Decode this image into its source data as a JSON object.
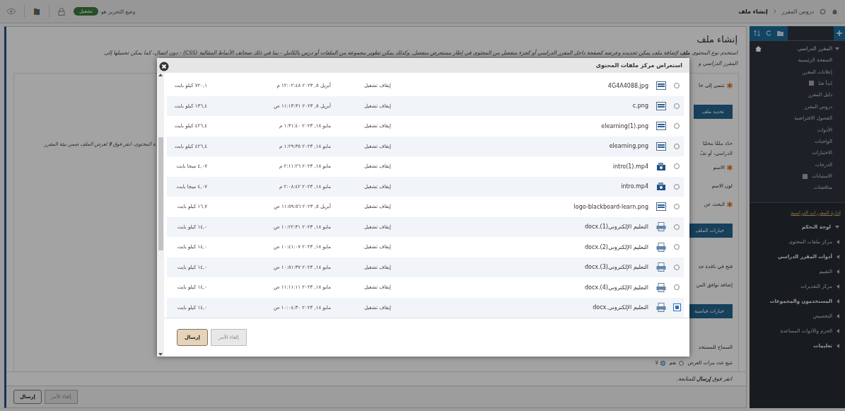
{
  "top_bar": {
    "breadcrumb": [
      {
        "label": "دروس المقرر"
      },
      {
        "label": "إنشاء ملف"
      }
    ],
    "edit_mode": {
      "label": "وضع التحرير هو",
      "state": "تشغيل",
      "on": true
    }
  },
  "sidebar": {
    "course_title": "المقرر الدراسي",
    "course_expanded": true,
    "course_items": [
      {
        "label": "الصفحة الرئيسية",
        "kind": "link"
      },
      {
        "label": "إعلانات المقرر",
        "kind": "link"
      },
      {
        "label": "ابدأ هنا",
        "kind": "flagged"
      },
      {
        "label": "دليل المقرر",
        "kind": "link"
      },
      {
        "label": "دروس المقرر",
        "kind": "link"
      },
      {
        "label": "الفصول الافتراضية",
        "kind": "link"
      },
      {
        "label": "الأدوات",
        "kind": "link"
      },
      {
        "label": "الواجبات",
        "kind": "link"
      },
      {
        "label": "الاختبارات",
        "kind": "link"
      },
      {
        "label": "الدرجات",
        "kind": "link"
      },
      {
        "label": "الاستبانات",
        "kind": "flagged"
      },
      {
        "label": "مناقشات",
        "kind": "link"
      }
    ],
    "management_title": "إدارة المقررات الدراسية",
    "control_panel": "لوحة التحكم",
    "control_panel_expanded": true,
    "management_items": [
      {
        "label": "مركز ملفات المحتوى",
        "bold": false
      },
      {
        "label": "أدوات المقرر الدراسي",
        "bold": true
      },
      {
        "label": "التقييم",
        "bold": false
      },
      {
        "label": "مركز التقديرات",
        "bold": false
      },
      {
        "label": "المستخدمون والمجموعات",
        "bold": true
      },
      {
        "label": "التخصيص",
        "bold": false
      },
      {
        "label": "الحزم والأدوات المساعدة",
        "bold": false
      },
      {
        "label": "تعليمات",
        "bold": true
      }
    ]
  },
  "page": {
    "title": "إنشاء ملف",
    "description": "استخدم نوع المحتوى **ملف** لإضافة ملف يمكن تحديده وعرضه كصفحة داخل المقرر الدراسي أو كجزء منفصل من المحتوى في إطار مستعرض منفصل. وكذلك يمكن تطوير مجموعة من الملفات أو درس بالكامل - بما في ذلك صحائف الأنماط المتتالية (CSS) - دون اتصال، كما يمكن تحميلها إلى",
    "description_cont": "المقرر الدراسي و",
    "form": [
      {
        "kind": "label",
        "text": "تنتمي إلى حا",
        "required": true
      },
      {
        "kind": "button",
        "text": "تحديد ملف"
      },
      {
        "kind": "text",
        "text": "حدّد ملفًا محليًا"
      },
      {
        "kind": "text",
        "text": "الدراسي، أو نفّ"
      },
      {
        "kind": "label",
        "text": "الاسم",
        "required": true
      },
      {
        "kind": "label",
        "text": "لون الاسم",
        "required": false
      },
      {
        "kind": "label",
        "text": "البحث عن",
        "required": true
      },
      {
        "kind": "button",
        "text": "خيارات الملف"
      },
      {
        "kind": "label",
        "text": "فتح في نافذة جد",
        "required": false
      },
      {
        "kind": "label",
        "text": "إضافة توافق الس",
        "required": false
      },
      {
        "kind": "button",
        "text": "خيارات قياسية"
      },
      {
        "kind": "label",
        "text": "السماح للمستخد",
        "required": false
      },
      {
        "kind": "radio",
        "text": "تتبع عدد مرات العرض",
        "options": [
          {
            "label": "نعم",
            "selected": false
          },
          {
            "label": "لا",
            "selected": true
          }
        ]
      }
    ],
    "side_note": "ة المحتوى، انقر فوق **لا** لعرض الملف ضمن بيئة المقرر",
    "submit_hint": "انقر فوق **إرسال** للمتابعة.",
    "buttons": [
      {
        "label": "إلغاء الأمر",
        "kind": "secondary"
      },
      {
        "label": "إرسال",
        "kind": "primary"
      }
    ]
  },
  "dialog": {
    "title": "استعراض مركز ملفات المحتوى",
    "rows": [
      {
        "selected": false,
        "kind": "image",
        "name": "4G4A4088.jpg",
        "status": "إيقاف تشغيل",
        "date": "أبريل ٥, ٢٠٢٣ ١٢:٠٢:٤٨ م",
        "size": "٧٢٠,١ كيلو بايت"
      },
      {
        "selected": false,
        "kind": "image",
        "name": "c.png",
        "status": "إيقاف تشغيل",
        "date": "أبريل ٥, ٢٠٢٣ ١١:١٣:٣١ ص",
        "size": "١٣٦,٤ كيلو بايت"
      },
      {
        "selected": false,
        "kind": "image",
        "name": "elearning(1).png",
        "status": "إيقاف تشغيل",
        "date": "مايو ١٨, ٢٠٢٣ ١:٣١:٤٠ م",
        "size": "٤٢٦,٤ كيلو بايت"
      },
      {
        "selected": false,
        "kind": "image",
        "name": "elearning.png",
        "status": "إيقاف تشغيل",
        "date": "مايو ١٨, ٢٠٢٣ ١:٢٩:٣٥ م",
        "size": "٤٢٦,٤ كيلو بايت"
      },
      {
        "selected": false,
        "kind": "video",
        "name": "intro(1).mp4",
        "status": "إيقاف تشغيل",
        "date": "مايو ١٨, ٢٠٢٣ ٢:١١:٢٦ م",
        "size": "٤,٠٧ ميجا بايت"
      },
      {
        "selected": false,
        "kind": "video",
        "name": "intro.mp4",
        "status": "إيقاف تشغيل",
        "date": "مايو ١٨, ٢٠٢٣ ٢:٠٨:٤٢ م",
        "size": "٤,٠٧ ميجا بايت"
      },
      {
        "selected": false,
        "kind": "image",
        "name": "logo-blackboard-learn.png",
        "status": "إيقاف تشغيل",
        "date": "أبريل ٥, ٢٠٢٣ ١١:٥٩:٥٦ ص",
        "size": "١٦,٧ كيلو بايت"
      },
      {
        "selected": false,
        "kind": "document",
        "name": "التعليم الإلكتروني(1).docx",
        "status": "إيقاف تشغيل",
        "date": "مايو ١٨, ٢٠٢٣ ١٠:٢٢:٣١ ص",
        "size": "١٤,٠ كيلو بايت"
      },
      {
        "selected": false,
        "kind": "document",
        "name": "التعليم الإلكتروني(2).docx",
        "status": "إيقاف تشغيل",
        "date": "مايو ١٨, ٢٠٢٣ ١٠:٤١:٠٧ ص",
        "size": "١٤,٠ كيلو بايت"
      },
      {
        "selected": false,
        "kind": "document",
        "name": "التعليم الإلكتروني(3).docx",
        "status": "إيقاف تشغيل",
        "date": "مايو ١٨, ٢٠٢٣ ١٠:٥١:٣٧ ص",
        "size": "١٤,٠ كيلو بايت"
      },
      {
        "selected": false,
        "kind": "document",
        "name": "التعليم الإلكتروني(4).docx",
        "status": "إيقاف تشغيل",
        "date": "مايو ١٨, ٢٠٢٣ ١١:١١:١١ ص",
        "size": "١٤,٠ كيلو بايت"
      },
      {
        "selected": true,
        "kind": "document",
        "name": "التعليم الإلكتروني.docx",
        "status": "إيقاف تشغيل",
        "date": "مايو ١٨, ٢٠٢٣ ١٠:٠٤:٣٠ ص",
        "size": "١٤,٠ كيلو بايت"
      }
    ],
    "buttons": [
      {
        "label": "إلغاء الأمر",
        "kind": "secondary"
      },
      {
        "label": "إرسال",
        "kind": "primary"
      }
    ]
  }
}
